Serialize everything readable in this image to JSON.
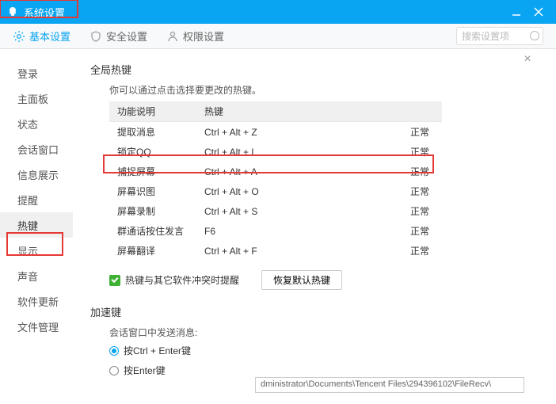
{
  "title": "系统设置",
  "tabs": {
    "basic": "基本设置",
    "security": "安全设置",
    "permission": "权限设置"
  },
  "search_placeholder": "搜索设置项",
  "sidebar": {
    "items": [
      {
        "label": "登录"
      },
      {
        "label": "主面板"
      },
      {
        "label": "状态"
      },
      {
        "label": "会话窗口"
      },
      {
        "label": "信息展示"
      },
      {
        "label": "提醒"
      },
      {
        "label": "热键"
      },
      {
        "label": "显示"
      },
      {
        "label": "声音"
      },
      {
        "label": "软件更新"
      },
      {
        "label": "文件管理"
      }
    ],
    "active_index": 6
  },
  "global_hotkey": {
    "title": "全局热键",
    "desc": "你可以通过点击选择要更改的热键。",
    "col_func": "功能说明",
    "col_key": "热键",
    "rows": [
      {
        "func": "提取消息",
        "key": "Ctrl + Alt + Z",
        "status": "正常"
      },
      {
        "func": "锁定QQ",
        "key": "Ctrl + Alt + L",
        "status": "正常"
      },
      {
        "func": "捕捉屏幕",
        "key": "Ctrl + Alt + A",
        "status": "正常"
      },
      {
        "func": "屏幕识图",
        "key": "Ctrl + Alt + O",
        "status": "正常"
      },
      {
        "func": "屏幕录制",
        "key": "Ctrl + Alt + S",
        "status": "正常"
      },
      {
        "func": "群通话按住发言",
        "key": "F6",
        "status": "正常"
      },
      {
        "func": "屏幕翻译",
        "key": "Ctrl + Alt + F",
        "status": "正常"
      }
    ],
    "conflict_chk_label": "热键与其它软件冲突时提醒",
    "restore_btn": "恢复默认热键"
  },
  "accel": {
    "title": "加速键",
    "send_label": "会话窗口中发送消息:",
    "options": [
      {
        "label": "按Ctrl + Enter键",
        "selected": true
      },
      {
        "label": "按Enter键",
        "selected": false
      }
    ]
  },
  "path_value": "dministrator\\Documents\\Tencent Files\\294396102\\FileRecv\\"
}
